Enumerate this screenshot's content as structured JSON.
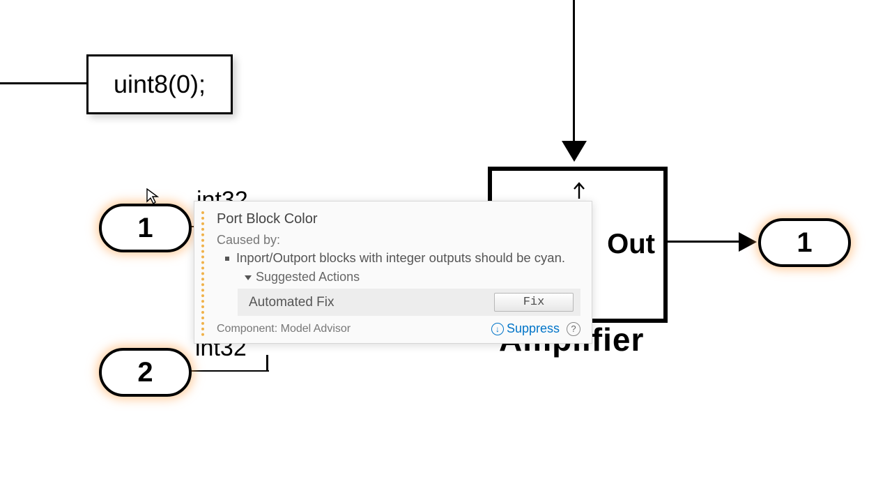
{
  "blocks": {
    "uint8_constant": "uint8(0);",
    "inport1_label": "1",
    "inport2_label": "2",
    "signal1_type": "int32",
    "signal2_type": "int32",
    "outport_label": "1",
    "subsystem_port_label": "Out",
    "subsystem_name": "Amplifier"
  },
  "popup": {
    "title": "Port Block Color",
    "caused_by_label": "Caused by:",
    "message": "Inport/Outport blocks with integer outputs should be cyan.",
    "suggested_actions_label": "Suggested Actions",
    "fix_label": "Automated Fix",
    "fix_button": "Fix",
    "component_label": "Component: Model Advisor",
    "suppress_label": "Suppress",
    "help_glyph": "?",
    "download_glyph": "↓"
  }
}
